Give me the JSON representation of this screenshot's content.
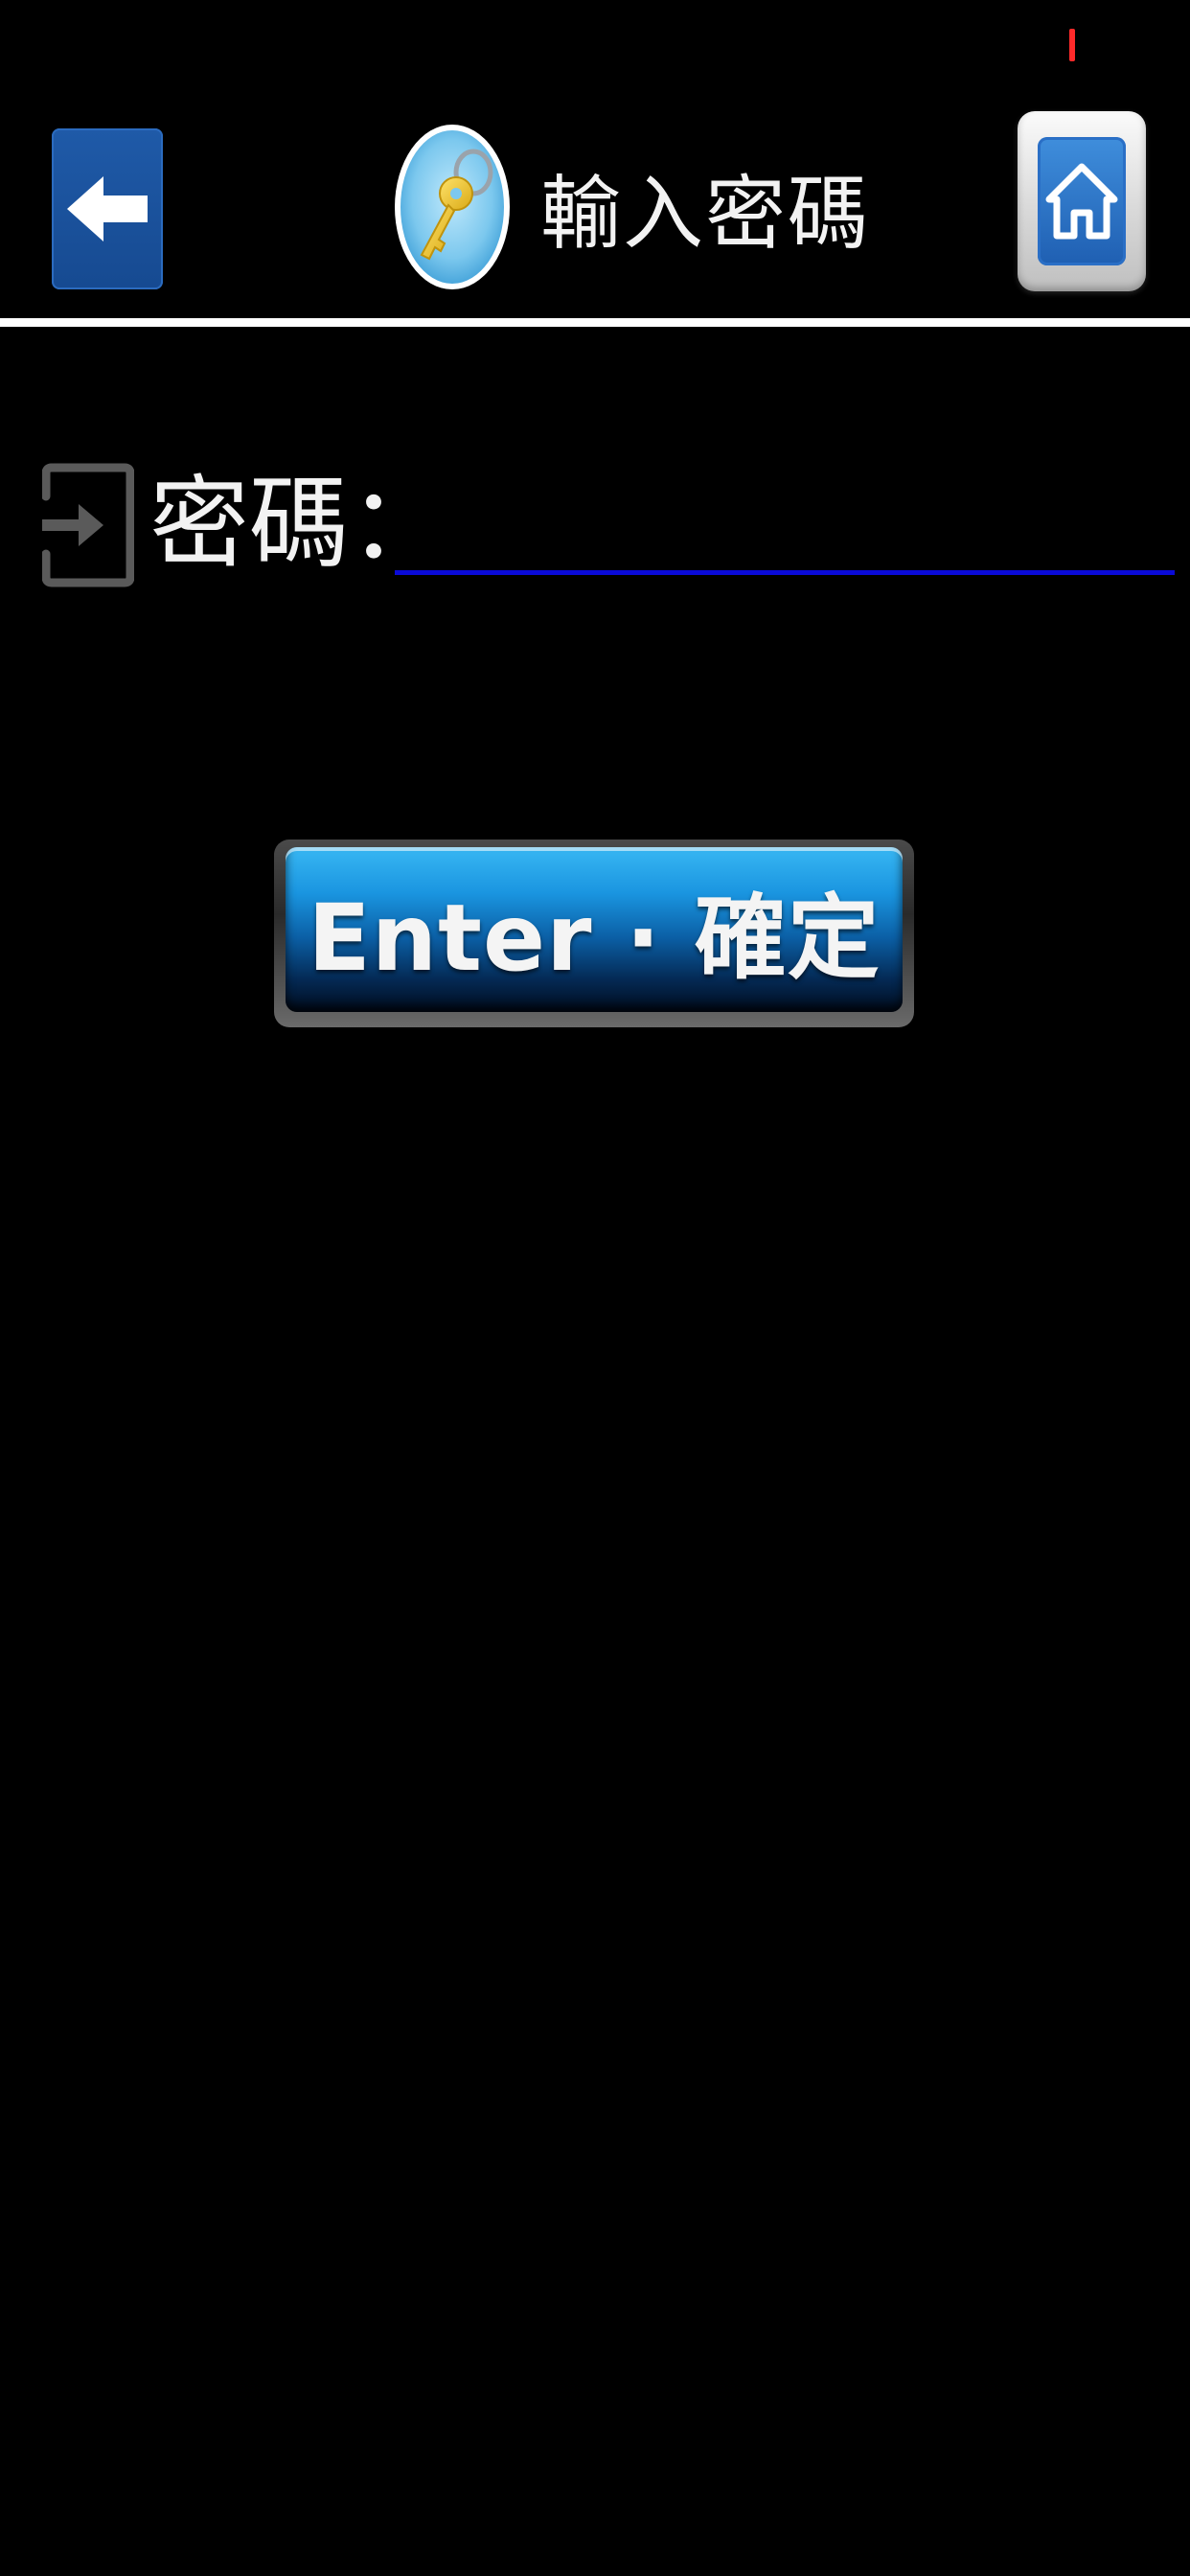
{
  "header": {
    "title": "輸入密碼",
    "back_icon": "arrow-left-icon",
    "title_icon": "key-icon",
    "home_icon": "home-icon"
  },
  "form": {
    "password_label": "密碼：",
    "password_value": "",
    "login_icon": "login-icon",
    "input_underline_color": "#0a0ad8"
  },
  "actions": {
    "enter_label": "Enter · 確定"
  },
  "colors": {
    "background": "#000000",
    "accent_blue": "#1a95e0",
    "status_mark": "#ff2a2a"
  }
}
